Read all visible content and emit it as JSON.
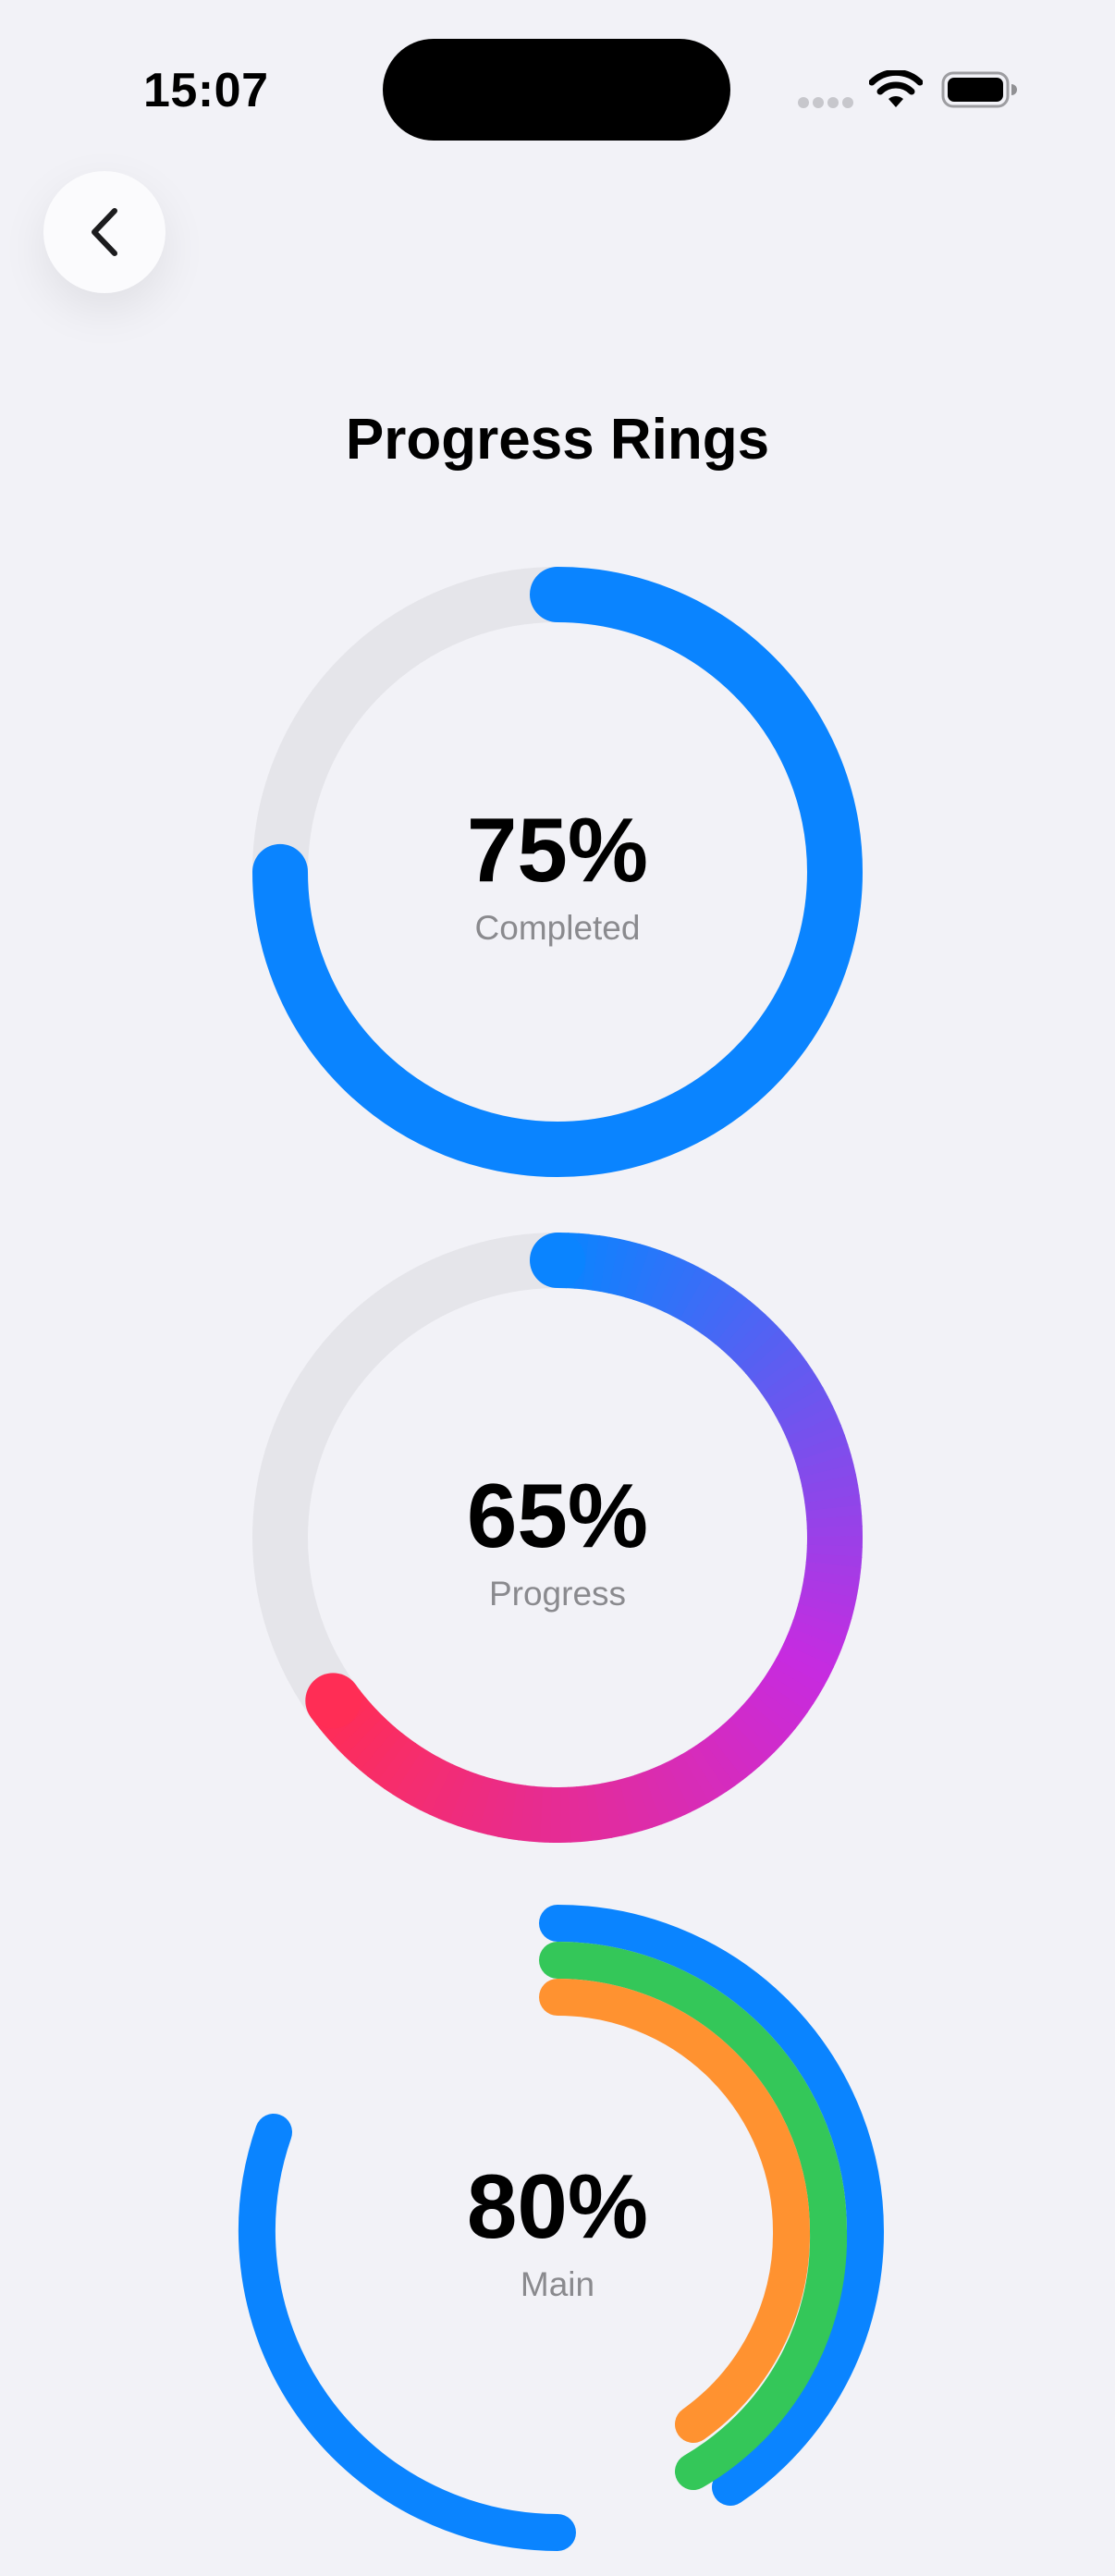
{
  "status_bar": {
    "time": "15:07"
  },
  "navigation": {
    "back_icon": "chevron-left-icon"
  },
  "page": {
    "title": "Progress Rings"
  },
  "rings": [
    {
      "value": "75%",
      "label": "Completed",
      "fraction": 0.75,
      "color": "#0a84ff",
      "track_color": "#e5e5ea"
    },
    {
      "value": "65%",
      "label": "Progress",
      "fraction": 0.65,
      "gradient": [
        "#0a84ff",
        "#c72be0",
        "#ff2d55"
      ],
      "track_color": "#e5e5ea"
    },
    {
      "value": "80%",
      "label": "Main",
      "arcs": [
        {
          "color": "#0a84ff"
        },
        {
          "color": "#34c759"
        },
        {
          "color": "#ff9230"
        }
      ]
    }
  ]
}
